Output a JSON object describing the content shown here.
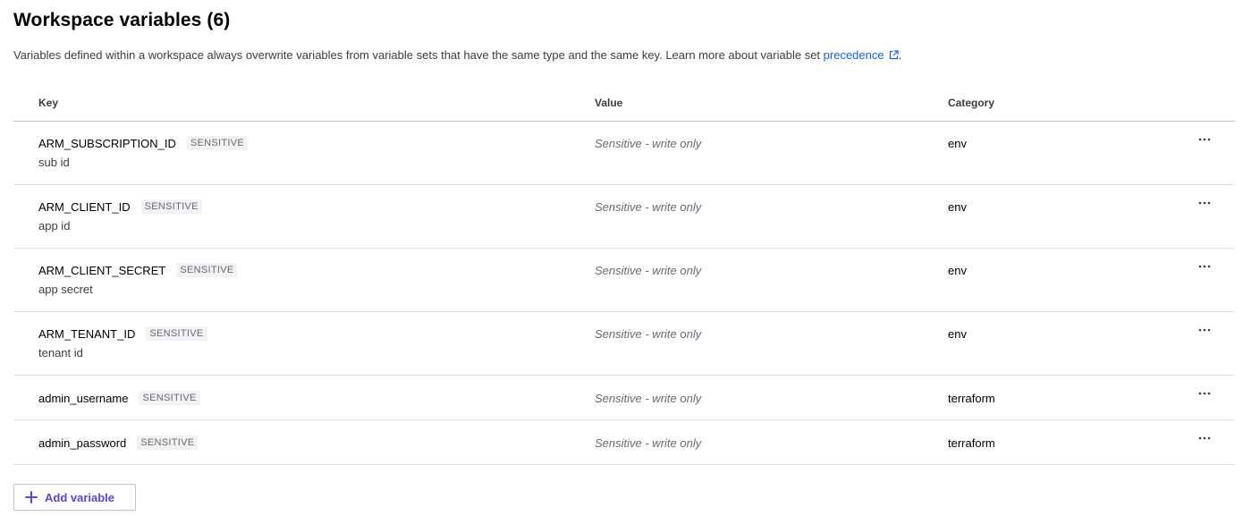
{
  "header": {
    "title": "Workspace variables (6)",
    "description": "Variables defined within a workspace always overwrite variables from variable sets that have the same type and the same key. Learn more about variable set ",
    "link_text": "precedence",
    "description_end": "."
  },
  "table": {
    "columns": {
      "key": "Key",
      "value": "Value",
      "category": "Category"
    },
    "rows": [
      {
        "key": "ARM_SUBSCRIPTION_ID",
        "badge": "SENSITIVE",
        "description": "sub id",
        "value": "Sensitive - write only",
        "category": "env"
      },
      {
        "key": "ARM_CLIENT_ID",
        "badge": "SENSITIVE",
        "description": "app id",
        "value": "Sensitive - write only",
        "category": "env"
      },
      {
        "key": "ARM_CLIENT_SECRET",
        "badge": "SENSITIVE",
        "description": "app secret",
        "value": "Sensitive - write only",
        "category": "env"
      },
      {
        "key": "ARM_TENANT_ID",
        "badge": "SENSITIVE",
        "description": "tenant id",
        "value": "Sensitive - write only",
        "category": "env"
      },
      {
        "key": "admin_username",
        "badge": "SENSITIVE",
        "description": "",
        "value": "Sensitive - write only",
        "category": "terraform"
      },
      {
        "key": "admin_password",
        "badge": "SENSITIVE",
        "description": "",
        "value": "Sensitive - write only",
        "category": "terraform"
      }
    ]
  },
  "actions": {
    "add_variable_label": "Add variable"
  },
  "icons": {
    "external_link": "external-link-icon",
    "row_menu": "more-horizontal-icon",
    "add": "plus-icon"
  },
  "colors": {
    "link": "#1060ff",
    "add_button_text": "#5c45d8",
    "badge_bg": "#f1f2f3",
    "muted_text": "#656a76"
  }
}
